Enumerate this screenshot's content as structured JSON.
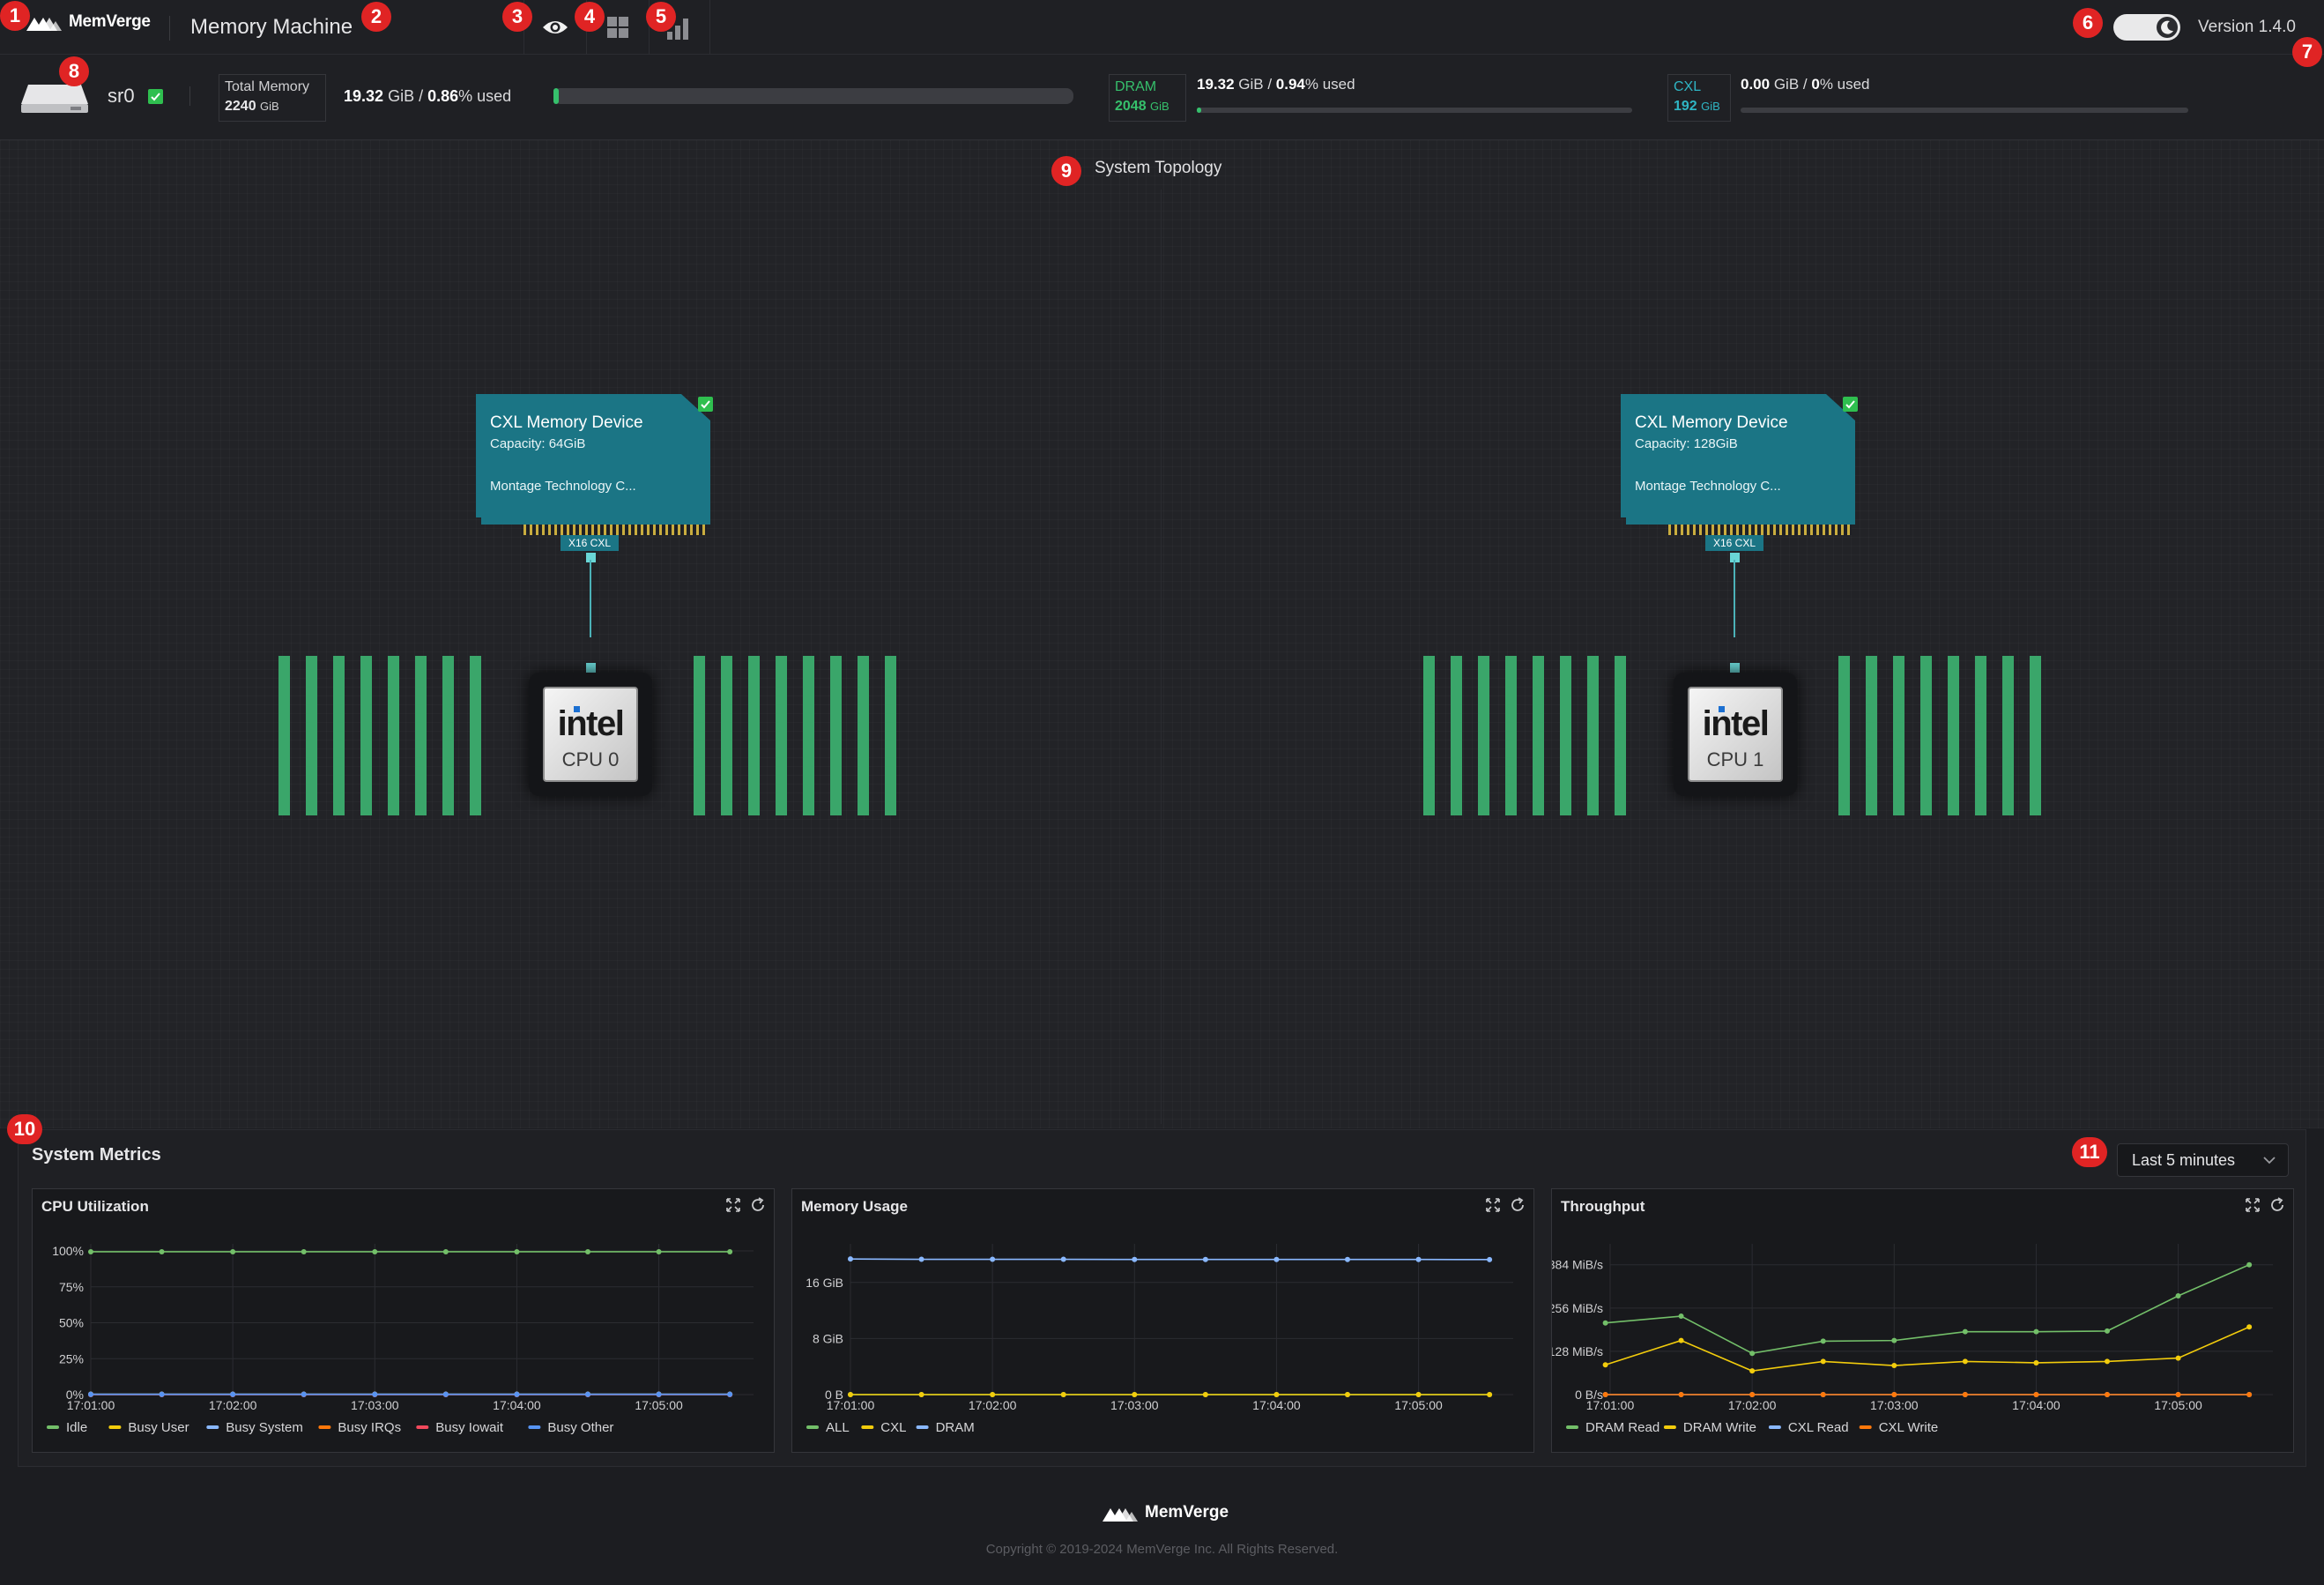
{
  "header": {
    "brand": "MemVerge",
    "app_title": "Memory Machine",
    "nav_icons": [
      "eye-icon",
      "dashboard-grid-icon",
      "bar-chart-icon"
    ],
    "theme_toggle_icon": "moon-icon",
    "version": "Version 1.4.0"
  },
  "badges": [
    "1",
    "2",
    "3",
    "4",
    "5",
    "6",
    "7",
    "8",
    "9",
    "10",
    "11"
  ],
  "server": {
    "name": "sr0",
    "status_icon": "check-icon",
    "total_label": "Total Memory",
    "total_value": "2240",
    "total_unit": "GiB",
    "used_amount": "19.32",
    "used_unit": "GiB",
    "used_sep": " / ",
    "used_pct": "0.86",
    "used_suffix": "% used",
    "used_fraction": 0.0086
  },
  "dram": {
    "label": "DRAM",
    "value": "2048",
    "unit": "GiB",
    "used_amount": "19.32",
    "used_unit": "GiB",
    "used_sep": " / ",
    "used_pct": "0.94",
    "used_suffix": "% used",
    "used_fraction": 0.0094
  },
  "cxl": {
    "label": "CXL",
    "value": "192",
    "unit": "GiB",
    "used_amount": "0.00",
    "used_unit": "GiB",
    "used_sep": " / ",
    "used_pct": "0",
    "used_suffix": "% used",
    "used_fraction": 0
  },
  "topology": {
    "title": "System Topology",
    "devices": [
      {
        "name": "CXL Memory Device",
        "capacity": "Capacity: 64GiB",
        "vendor": "Montage Technology C...",
        "link": "X16 CXL"
      },
      {
        "name": "CXL Memory Device",
        "capacity": "Capacity: 128GiB",
        "vendor": "Montage Technology C...",
        "link": "X16 CXL"
      }
    ],
    "cpus": [
      {
        "brand": "intel",
        "label": "CPU 0"
      },
      {
        "brand": "intel",
        "label": "CPU 1"
      }
    ]
  },
  "metrics": {
    "title": "System Metrics",
    "range": "Last 5 minutes",
    "panel_icons": [
      "expand-icon",
      "refresh-icon"
    ],
    "panels": [
      {
        "title": "CPU Utilization"
      },
      {
        "title": "Memory Usage"
      },
      {
        "title": "Throughput"
      }
    ]
  },
  "chart_data": [
    {
      "type": "line",
      "title": "CPU Utilization",
      "x": [
        "17:01:00",
        "17:01:30",
        "17:02:00",
        "17:02:30",
        "17:03:00",
        "17:03:30",
        "17:04:00",
        "17:04:30",
        "17:05:00",
        "17:05:30"
      ],
      "xticks": [
        "17:01:00",
        "17:02:00",
        "17:03:00",
        "17:04:00",
        "17:05:00"
      ],
      "yticks": [
        "100%",
        "75%",
        "50%",
        "25%",
        "0%"
      ],
      "ylim": [
        0,
        100
      ],
      "series": [
        {
          "name": "Idle",
          "color": "#73bf69",
          "values": [
            99.4,
            99.4,
            99.4,
            99.4,
            99.4,
            99.4,
            99.4,
            99.4,
            99.4,
            99.4
          ]
        },
        {
          "name": "Busy User",
          "color": "#f2cc0c",
          "values": [
            0.2,
            0.2,
            0.2,
            0.2,
            0.2,
            0.2,
            0.2,
            0.2,
            0.2,
            0.2
          ]
        },
        {
          "name": "Busy System",
          "color": "#8ab8ff",
          "values": [
            0.3,
            0.3,
            0.3,
            0.3,
            0.3,
            0.3,
            0.3,
            0.3,
            0.3,
            0.3
          ]
        },
        {
          "name": "Busy IRQs",
          "color": "#ff780a",
          "values": [
            0,
            0,
            0,
            0,
            0,
            0,
            0,
            0,
            0,
            0
          ]
        },
        {
          "name": "Busy Iowait",
          "color": "#f2495c",
          "values": [
            0,
            0,
            0,
            0,
            0,
            0,
            0,
            0,
            0,
            0
          ]
        },
        {
          "name": "Busy Other",
          "color": "#5794f2",
          "values": [
            0.1,
            0.1,
            0.1,
            0.1,
            0.1,
            0.1,
            0.1,
            0.1,
            0.1,
            0.1
          ]
        }
      ]
    },
    {
      "type": "line",
      "title": "Memory Usage",
      "x": [
        "17:01:00",
        "17:01:30",
        "17:02:00",
        "17:02:30",
        "17:03:00",
        "17:03:30",
        "17:04:00",
        "17:04:30",
        "17:05:00",
        "17:05:30"
      ],
      "xticks": [
        "17:01:00",
        "17:02:00",
        "17:03:00",
        "17:04:00",
        "17:05:00"
      ],
      "yticks": [
        "16 GiB",
        "8 GiB",
        "0 B"
      ],
      "ylim": [
        0,
        20.5
      ],
      "series": [
        {
          "name": "ALL",
          "color": "#73bf69",
          "values": [
            0,
            0,
            0,
            0,
            0,
            0,
            0,
            0,
            0,
            0
          ]
        },
        {
          "name": "CXL",
          "color": "#f2cc0c",
          "values": [
            0,
            0,
            0,
            0,
            0,
            0,
            0,
            0,
            0,
            0
          ]
        },
        {
          "name": "DRAM",
          "color": "#8ab8ff",
          "values": [
            19.35,
            19.3,
            19.3,
            19.3,
            19.28,
            19.28,
            19.28,
            19.28,
            19.28,
            19.26
          ]
        }
      ]
    },
    {
      "type": "line",
      "title": "Throughput",
      "x": [
        "17:00:58",
        "17:01:30",
        "17:02:00",
        "17:02:30",
        "17:03:00",
        "17:03:30",
        "17:04:00",
        "17:04:30",
        "17:05:00",
        "17:05:30"
      ],
      "xticks": [
        "17:01:00",
        "17:02:00",
        "17:03:00",
        "17:04:00",
        "17:05:00"
      ],
      "yticks": [
        "384 MiB/s",
        "256 MiB/s",
        "128 MiB/s",
        "0 B/s"
      ],
      "ylim": [
        0,
        425
      ],
      "series": [
        {
          "name": "DRAM Read",
          "color": "#73bf69",
          "values": [
            212,
            232,
            122,
            158,
            160,
            186,
            186,
            188,
            292,
            384
          ]
        },
        {
          "name": "DRAM Write",
          "color": "#f2cc0c",
          "values": [
            88,
            160,
            70,
            98,
            86,
            98,
            94,
            98,
            108,
            200
          ]
        },
        {
          "name": "CXL Read",
          "color": "#8ab8ff",
          "values": [
            0,
            0,
            0,
            0,
            0,
            0,
            0,
            0,
            0,
            0
          ]
        },
        {
          "name": "CXL Write",
          "color": "#ff780a",
          "values": [
            0,
            0,
            0,
            0,
            0,
            0,
            0,
            0,
            0,
            0
          ]
        }
      ]
    }
  ],
  "footer": {
    "brand": "MemVerge",
    "copyright": "Copyright © 2019-2024 MemVerge Inc. All Rights Reserved."
  }
}
